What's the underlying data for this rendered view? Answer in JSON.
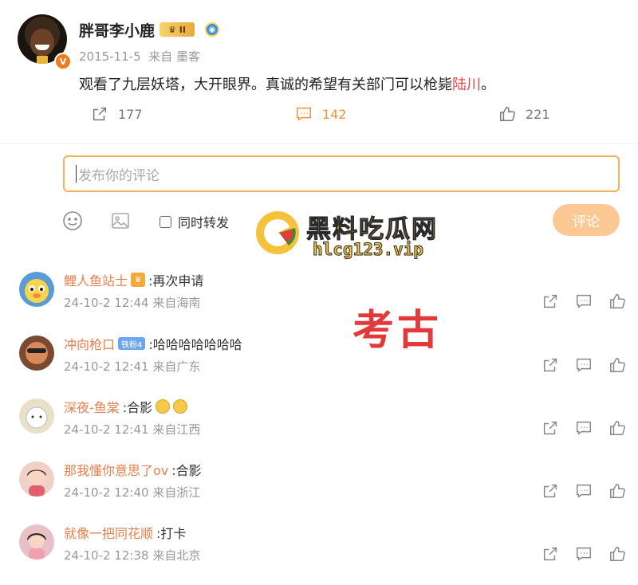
{
  "post": {
    "username": "胖哥李小鹿",
    "level_badge": "II",
    "verified_mark": "V",
    "date": "2015-11-5",
    "source": "来自 墨客",
    "content_before": "观看了九层妖塔，大开眼界。真诚的希望有关部门可以枪毙",
    "content_highlight": "陆川",
    "content_after": "。",
    "actions": {
      "forwards": "177",
      "comments": "142",
      "likes": "221"
    },
    "accent_color": "#f0903c"
  },
  "composer": {
    "placeholder": "发布你的评论",
    "forward_label": "同时转发",
    "submit_label": "评论"
  },
  "watermark": {
    "title": "黑料吃瓜网",
    "url": "hlcg123.vip",
    "stamp": "考古"
  },
  "comments": [
    {
      "name": "鲤人鱼站士",
      "badge": "",
      "text": ":再次申请",
      "time": "24-10-2 12:44",
      "location": "来自海南",
      "avatar_color": "#5a9bd5"
    },
    {
      "name": "冲向枪口",
      "badge": "铁粉4",
      "text": ":哈哈哈哈哈哈哈",
      "time": "24-10-2 12:41",
      "location": "来自广东",
      "avatar_color": "#c97b4a"
    },
    {
      "name": "深夜-鱼棠",
      "badge": "",
      "text": ":合影",
      "time": "24-10-2 12:41",
      "location": "来自江西",
      "avatar_color": "#e8e0c8"
    },
    {
      "name": "那我懂你意思了ov",
      "badge": "",
      "text": ":合影",
      "time": "24-10-2 12:40",
      "location": "来自浙江",
      "avatar_color": "#f0d0c8"
    },
    {
      "name": "就像一把同花顺",
      "badge": "",
      "text": ":打卡",
      "time": "24-10-2 12:38",
      "location": "来自北京",
      "avatar_color": "#e8c0c8"
    }
  ]
}
